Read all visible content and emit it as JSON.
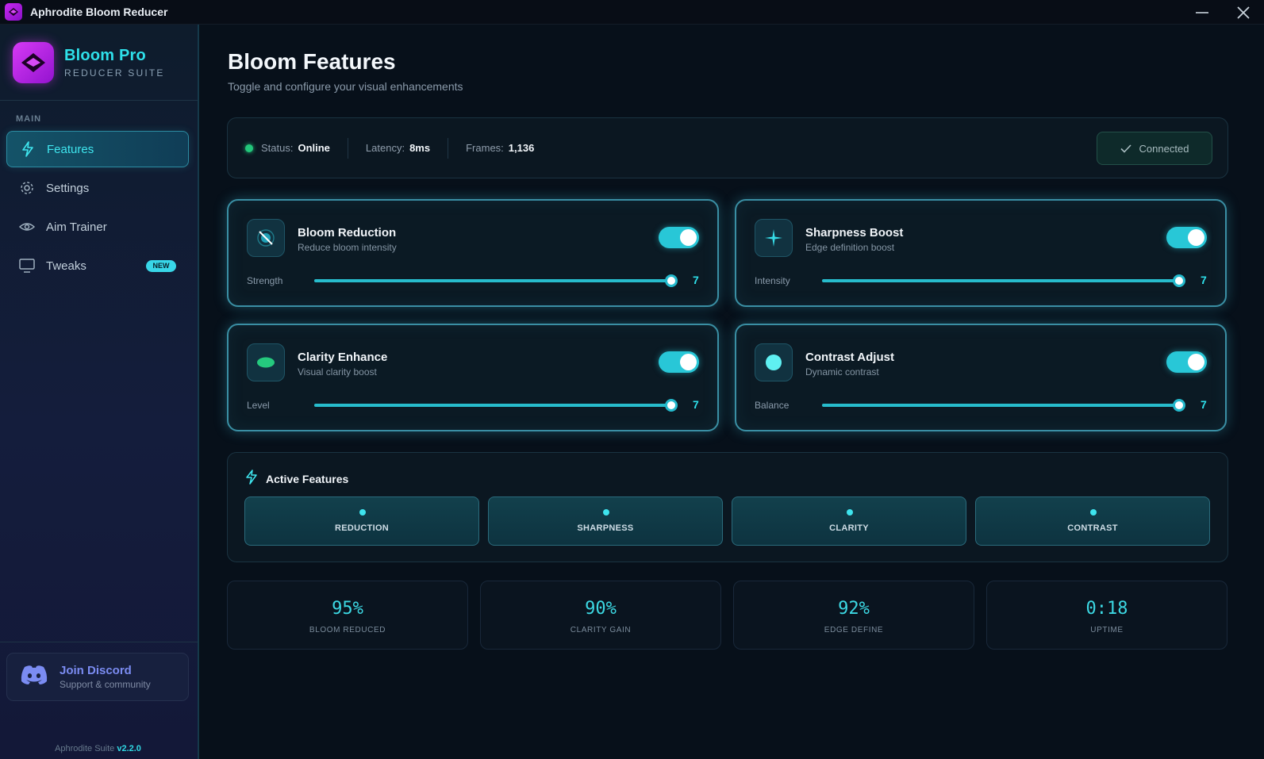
{
  "window": {
    "title": "Aphrodite Bloom Reducer"
  },
  "sidebar": {
    "brand_name": "Bloom Pro",
    "brand_sub": "REDUCER SUITE",
    "section_label": "MAIN",
    "items": [
      {
        "label": "Features",
        "icon": "lightning-icon",
        "active": true
      },
      {
        "label": "Settings",
        "icon": "gear-icon"
      },
      {
        "label": "Aim Trainer",
        "icon": "eye-icon"
      },
      {
        "label": "Tweaks",
        "icon": "monitor-icon",
        "badge": "NEW"
      }
    ],
    "discord": {
      "title": "Join Discord",
      "subtitle": "Support & community",
      "icon": "discord-icon"
    },
    "version_prefix": "Aphrodite Suite",
    "version": "v2.2.0"
  },
  "main": {
    "title": "Bloom Features",
    "subtitle": "Toggle and configure your visual enhancements"
  },
  "status_bar": {
    "status_label": "Status:",
    "status_value": "Online",
    "latency_label": "Latency:",
    "latency_value": "8ms",
    "frames_label": "Frames:",
    "frames_value": "1,136",
    "connected_label": "Connected",
    "status_color": "#22c67a"
  },
  "cards": [
    {
      "title": "Bloom Reduction",
      "subtitle": "Reduce bloom intensity",
      "icon": "bloom-off-icon",
      "enabled": true,
      "slider_label": "Strength",
      "value": "7",
      "fill_fraction": 1.0
    },
    {
      "title": "Sharpness Boost",
      "subtitle": "Edge definition boost",
      "icon": "sparkle-icon",
      "enabled": true,
      "slider_label": "Intensity",
      "value": "7",
      "fill_fraction": 1.0
    },
    {
      "title": "Clarity Enhance",
      "subtitle": "Visual clarity boost",
      "icon": "clarity-oval-icon",
      "enabled": true,
      "slider_label": "Level",
      "value": "7",
      "fill_fraction": 1.0
    },
    {
      "title": "Contrast Adjust",
      "subtitle": "Dynamic contrast",
      "icon": "contrast-circle-icon",
      "enabled": true,
      "slider_label": "Balance",
      "value": "7",
      "fill_fraction": 1.0
    }
  ],
  "active_features": {
    "title": "Active Features",
    "chips": [
      "REDUCTION",
      "SHARPNESS",
      "CLARITY",
      "CONTRAST"
    ]
  },
  "stats": [
    {
      "value": "95%",
      "label": "BLOOM REDUCED"
    },
    {
      "value": "90%",
      "label": "CLARITY GAIN"
    },
    {
      "value": "92%",
      "label": "EDGE DEFINE"
    },
    {
      "value": "0:18",
      "label": "UPTIME"
    }
  ],
  "colors": {
    "accent": "#2ee0ea",
    "brand": "#c528ee",
    "background": "#07101a"
  }
}
